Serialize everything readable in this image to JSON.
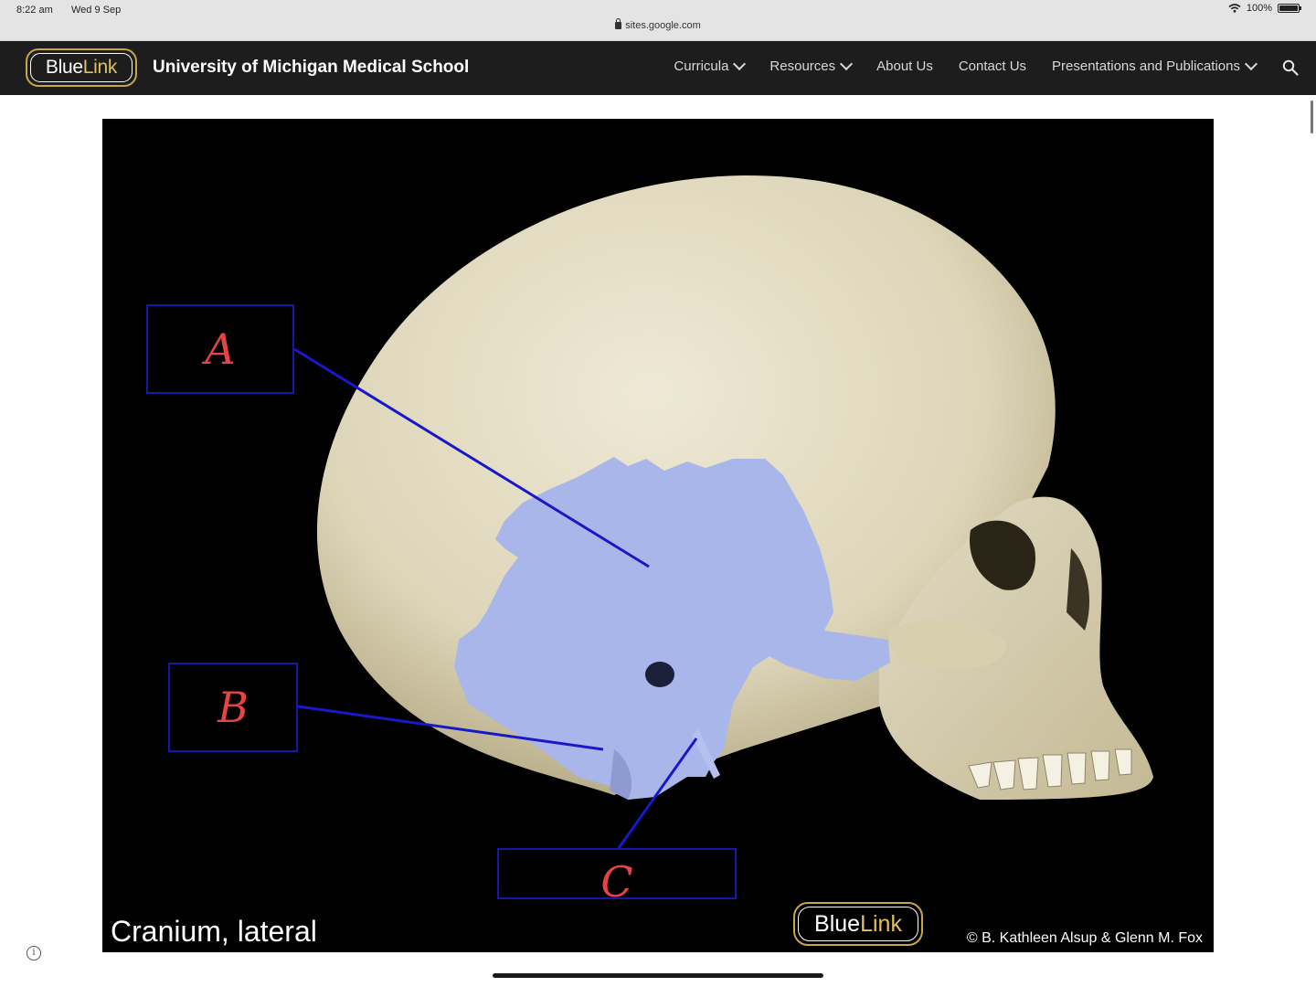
{
  "status": {
    "time": "8:22 am",
    "date": "Wed 9 Sep",
    "battery": "100%",
    "url": "sites.google.com"
  },
  "nav": {
    "logo_main": "Blue",
    "logo_accent": "Link",
    "site_title": "University of Michigan Medical School",
    "items": [
      {
        "label": "Curricula",
        "has_dropdown": true
      },
      {
        "label": "Resources",
        "has_dropdown": true
      },
      {
        "label": "About Us",
        "has_dropdown": false
      },
      {
        "label": "Contact Us",
        "has_dropdown": false
      },
      {
        "label": "Presentations and Publications",
        "has_dropdown": true
      }
    ]
  },
  "figure": {
    "labels": [
      "A",
      "B",
      "C"
    ],
    "caption": "Cranium, lateral",
    "logo_main": "Blue",
    "logo_accent": "Link",
    "copyright": "© B. Kathleen Alsup & Glenn M. Fox",
    "colors": {
      "label_box": "#1818a8",
      "label_text": "#e44444",
      "highlight": "#a9b6ea",
      "bone": "#e6e0c8"
    }
  },
  "icons": [
    "wifi-icon",
    "battery-icon",
    "lock-icon",
    "chevron-down-icon",
    "search-icon",
    "info-icon"
  ]
}
